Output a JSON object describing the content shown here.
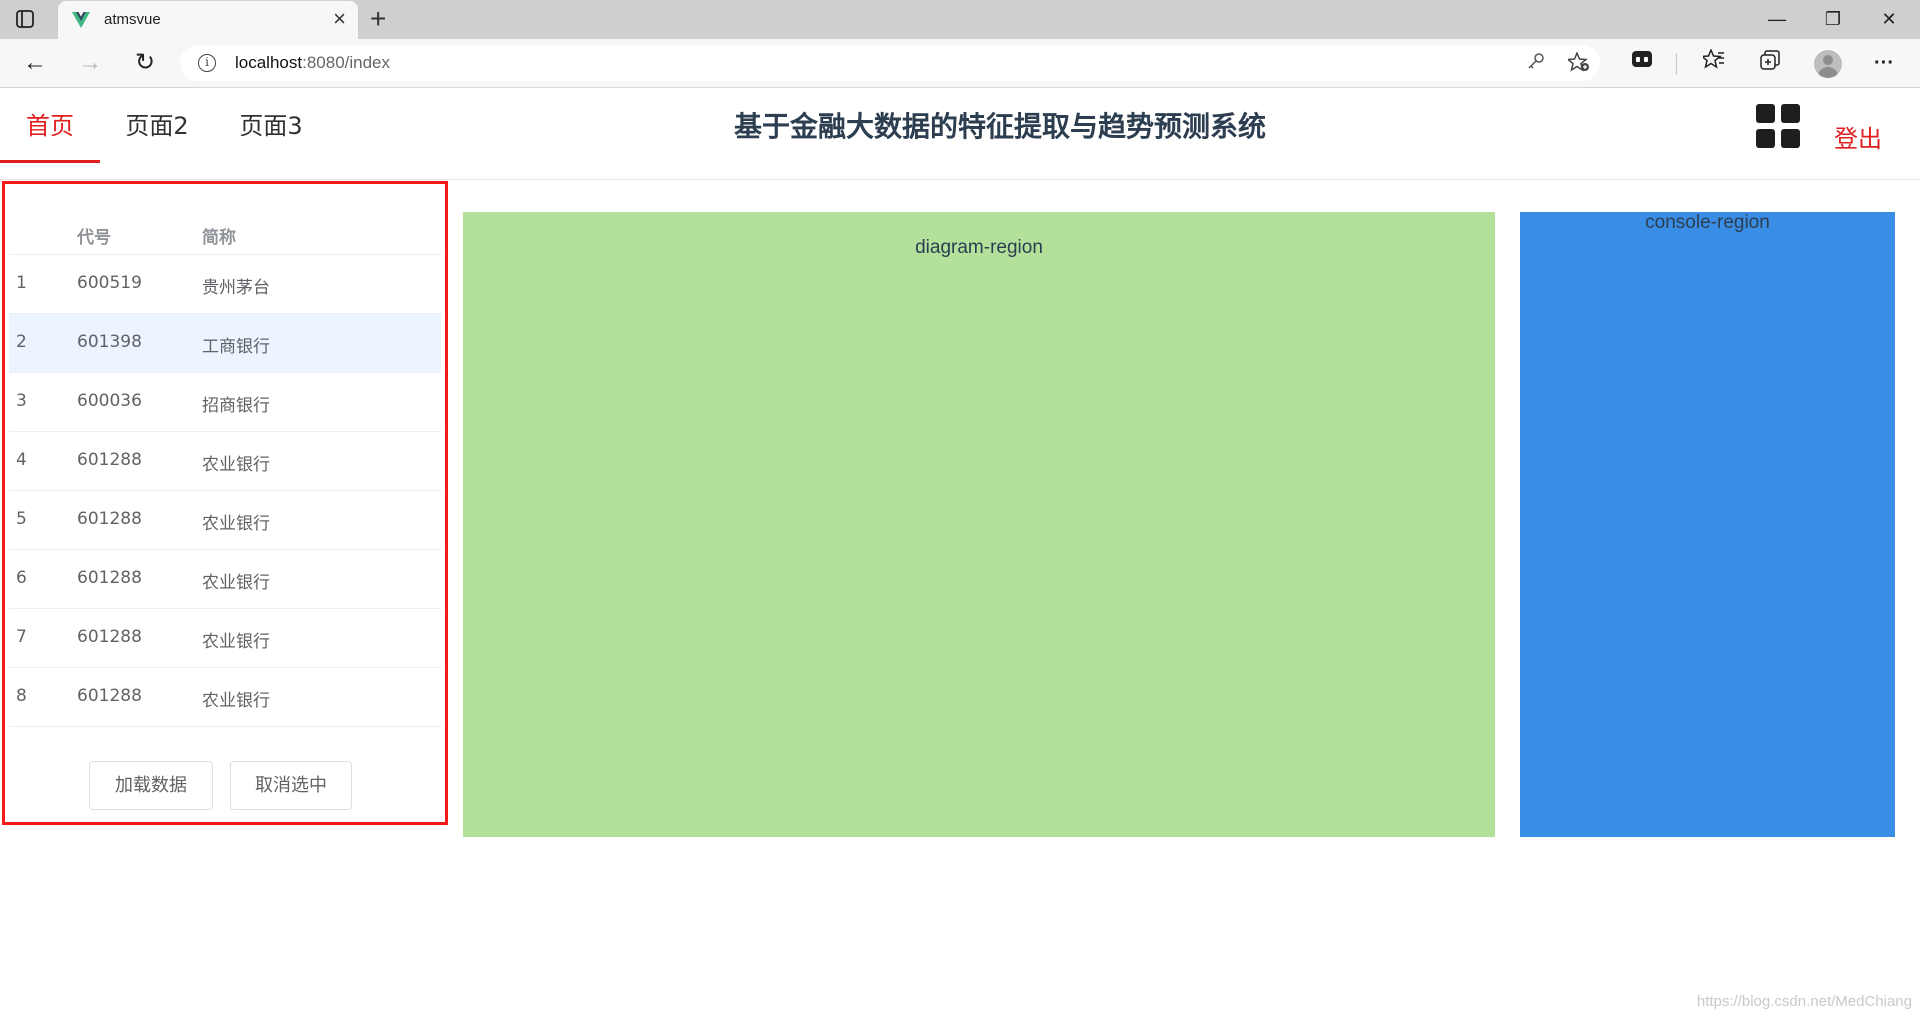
{
  "browser": {
    "tab_title": "atmsvue",
    "tab_close": "×",
    "new_tab": "+",
    "url_host": "localhost",
    "url_rest": ":8080/index",
    "window_minimize": "—",
    "window_restore": "❐",
    "window_close": "✕",
    "back": "←",
    "forward": "→",
    "reload": "↻",
    "info": "i",
    "menu_dots": "···",
    "icons": [
      "key-icon",
      "add-favorite-icon",
      "extension-icon",
      "favorites-icon",
      "collections-icon",
      "profile-icon",
      "more-icon"
    ]
  },
  "header": {
    "menu": [
      {
        "label": "首页",
        "active": true
      },
      {
        "label": "页面2",
        "active": false
      },
      {
        "label": "页面3",
        "active": false
      }
    ],
    "title": "基于金融大数据的特征提取与趋势预测系统",
    "logout": "登出",
    "accent_color": "#e02020"
  },
  "stock_table": {
    "columns": [
      "代号",
      "简称"
    ],
    "rows": [
      {
        "index": "1",
        "code": "600519",
        "name": "贵州茅台"
      },
      {
        "index": "2",
        "code": "601398",
        "name": "工商银行"
      },
      {
        "index": "3",
        "code": "600036",
        "name": "招商银行"
      },
      {
        "index": "4",
        "code": "601288",
        "name": "农业银行"
      },
      {
        "index": "5",
        "code": "601288",
        "name": "农业银行"
      },
      {
        "index": "6",
        "code": "601288",
        "name": "农业银行"
      },
      {
        "index": "7",
        "code": "601288",
        "name": "农业银行"
      },
      {
        "index": "8",
        "code": "601288",
        "name": "农业银行"
      }
    ],
    "hovered_row": 2,
    "buttons": {
      "load": "加载数据",
      "deselect": "取消选中"
    },
    "border_color": "#f31a1a"
  },
  "regions": {
    "diagram": {
      "label": "diagram-region",
      "color": "#b3e09b"
    },
    "console": {
      "label": "console-region",
      "color": "#3a8de4"
    }
  },
  "watermark": "https://blog.csdn.net/MedChiang"
}
